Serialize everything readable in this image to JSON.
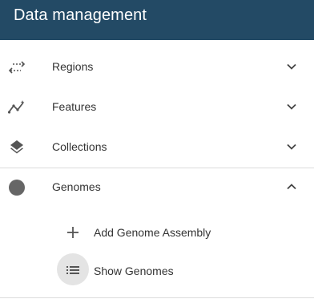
{
  "header": {
    "title": "Data management"
  },
  "menu": {
    "items": [
      {
        "label": "Regions",
        "icon": "swap-arrows-icon",
        "expanded": false
      },
      {
        "label": "Features",
        "icon": "trend-line-icon",
        "expanded": false
      },
      {
        "label": "Collections",
        "icon": "layers-icon",
        "expanded": false
      },
      {
        "label": "Genomes",
        "icon": "circle-icon",
        "expanded": true
      }
    ],
    "genomes_sub": [
      {
        "label": "Add Genome Assembly",
        "icon": "plus-icon"
      },
      {
        "label": "Show Genomes",
        "icon": "list-icon"
      }
    ]
  },
  "colors": {
    "header_bg": "#234a65",
    "icon": "#555555",
    "highlight": "#e4e4e4"
  }
}
